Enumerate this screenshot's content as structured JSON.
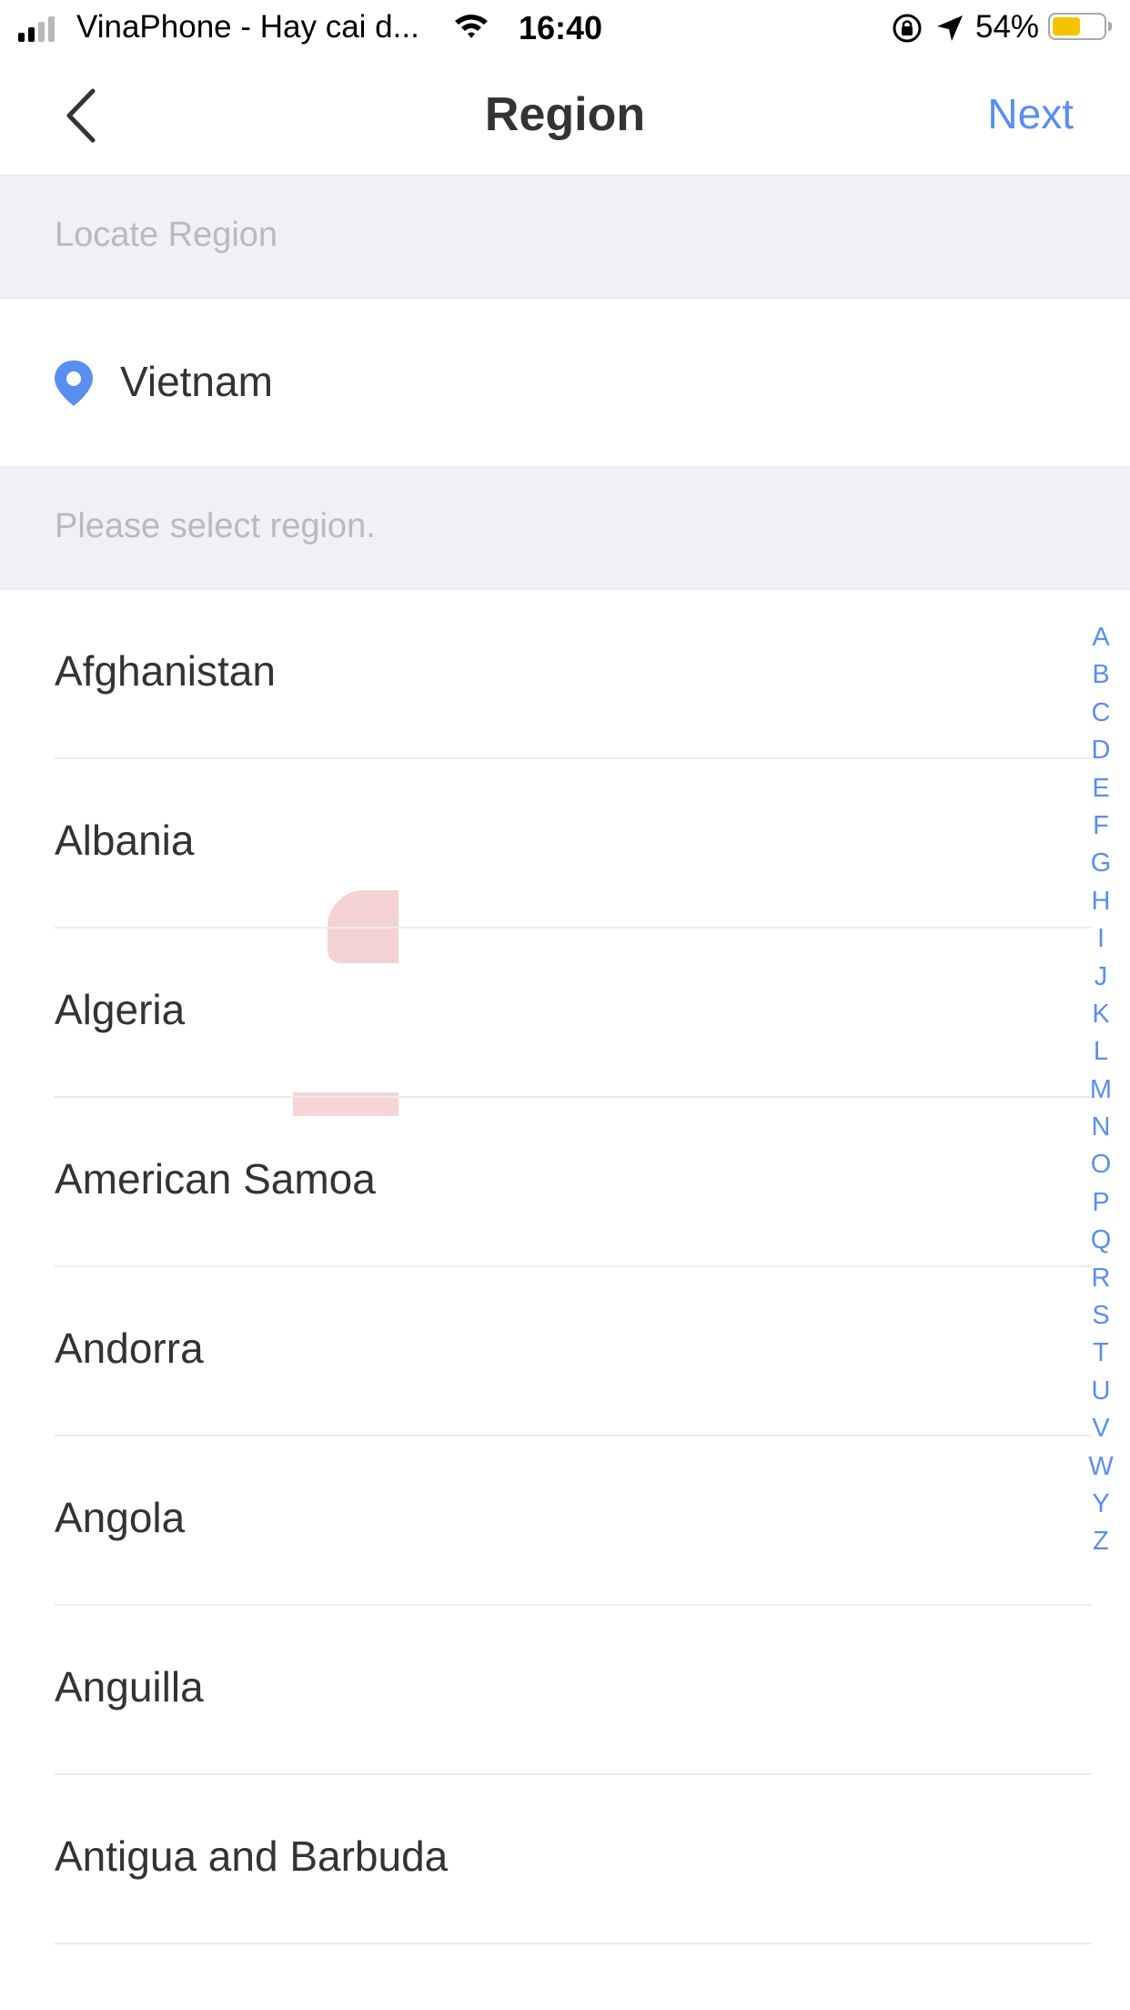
{
  "status_bar": {
    "carrier": "VinaPhone - Hay cai d...",
    "time": "16:40",
    "battery": "54%",
    "battery_level": 0.54
  },
  "nav": {
    "title": "Region",
    "next_label": "Next"
  },
  "locate_header": "Locate Region",
  "current_region": "Vietnam",
  "select_header": "Please select region.",
  "regions": [
    "Afghanistan",
    "Albania",
    "Algeria",
    "American Samoa",
    "Andorra",
    "Angola",
    "Anguilla",
    "Antigua and Barbuda"
  ],
  "index_letters": [
    "A",
    "B",
    "C",
    "D",
    "E",
    "F",
    "G",
    "H",
    "I",
    "J",
    "K",
    "L",
    "M",
    "N",
    "O",
    "P",
    "Q",
    "R",
    "S",
    "T",
    "U",
    "V",
    "W",
    "Y",
    "Z"
  ],
  "colors": {
    "accent": "#5a8ef0",
    "header_bg": "#f0f1f5",
    "text": "#333333",
    "header_text": "#b8bac0"
  }
}
